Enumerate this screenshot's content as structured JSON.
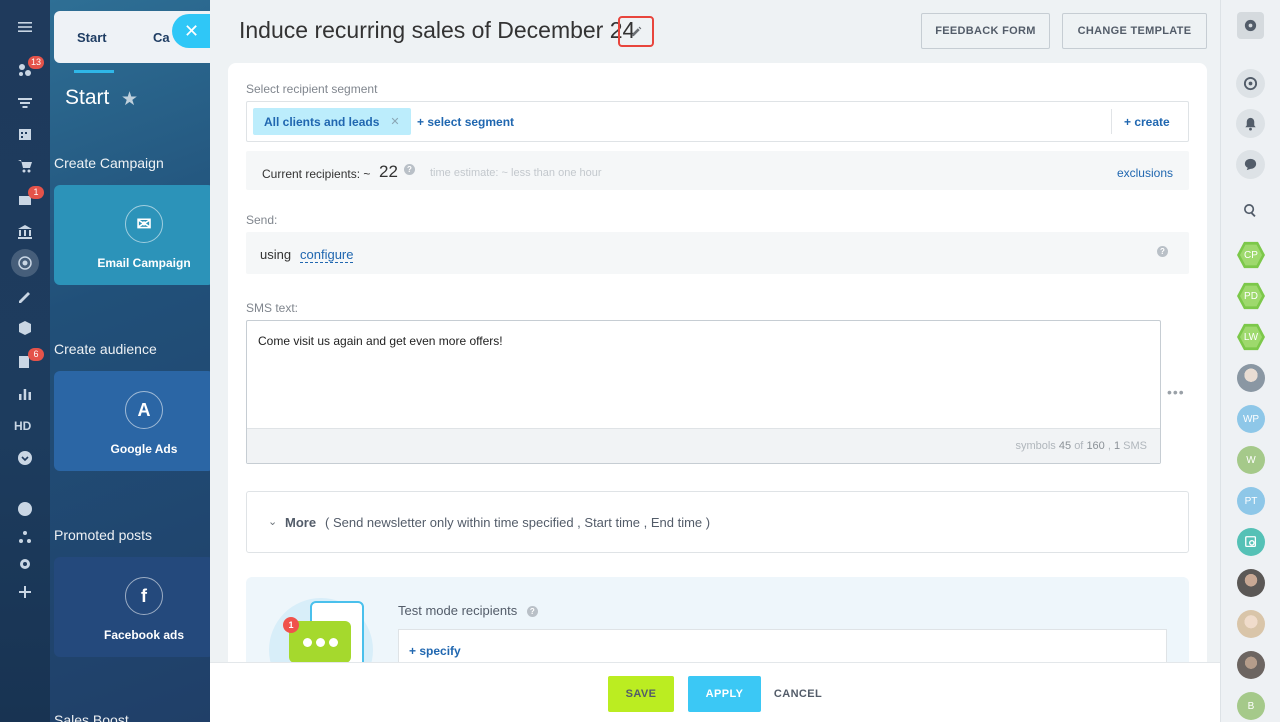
{
  "rail": {
    "badges": {
      "activity": "13",
      "inbox": "1",
      "tasks": "6"
    },
    "hd_label": "HD"
  },
  "background_page": {
    "tabs": [
      {
        "label": "Start"
      },
      {
        "label": "Ca"
      }
    ],
    "title": "Start",
    "sections": [
      {
        "heading": "Create Campaign",
        "card_label": "Email Campaign",
        "card_icon": "envelope-icon"
      },
      {
        "heading": "Create audience",
        "card_label": "Google Ads",
        "card_icon": "google-ads-icon"
      },
      {
        "heading": "Promoted posts",
        "card_label": "Facebook ads",
        "card_icon": "facebook-icon"
      }
    ],
    "bottom_heading": "Sales Boost"
  },
  "panel": {
    "title": "Induce recurring sales of December 24",
    "header_buttons": {
      "feedback": "FEEDBACK FORM",
      "change_template": "CHANGE TEMPLATE"
    },
    "segment": {
      "label": "Select recipient segment",
      "chip": "All clients and leads",
      "select_link": "+ select segment",
      "create_link": "+ create"
    },
    "recipients": {
      "label": "Current recipients: ~",
      "count": "22",
      "estimate": "time estimate: ~ less than one hour",
      "exclusions": "exclusions"
    },
    "send": {
      "label": "Send:",
      "using": "using",
      "configure": "configure"
    },
    "sms": {
      "label": "SMS text:",
      "text": "Come visit us again and get even more offers!",
      "counter_prefix": "symbols",
      "symbols": "45",
      "counter_of": "of",
      "max": "160",
      "sms_count": "1",
      "counter_suffix": "SMS"
    },
    "more": {
      "label": "More",
      "options": "( Send newsletter only within time specified ,  Start time ,  End time  )"
    },
    "test": {
      "label": "Test mode recipients",
      "specify": "+ specify",
      "badge": "1"
    },
    "footer": {
      "save": "SAVE",
      "apply": "APPLY",
      "cancel": "CANCEL"
    }
  },
  "right_sidebar": {
    "avatars": [
      {
        "initials": "CP",
        "kind": "hex"
      },
      {
        "initials": "PD",
        "kind": "hex"
      },
      {
        "initials": "LW",
        "kind": "hex"
      },
      {
        "initials": "",
        "kind": "photo"
      },
      {
        "initials": "WP",
        "kind": "circle"
      },
      {
        "initials": "W",
        "kind": "circle"
      },
      {
        "initials": "PT",
        "kind": "circle"
      },
      {
        "initials": "",
        "kind": "search"
      },
      {
        "initials": "",
        "kind": "photo"
      },
      {
        "initials": "",
        "kind": "photo"
      },
      {
        "initials": "",
        "kind": "photo"
      },
      {
        "initials": "B",
        "kind": "circle"
      }
    ]
  },
  "colors": {
    "accent_blue": "#2067b0",
    "save_green": "#bbed21",
    "apply_blue": "#3bc8f5",
    "highlight_red": "#e8453c"
  }
}
